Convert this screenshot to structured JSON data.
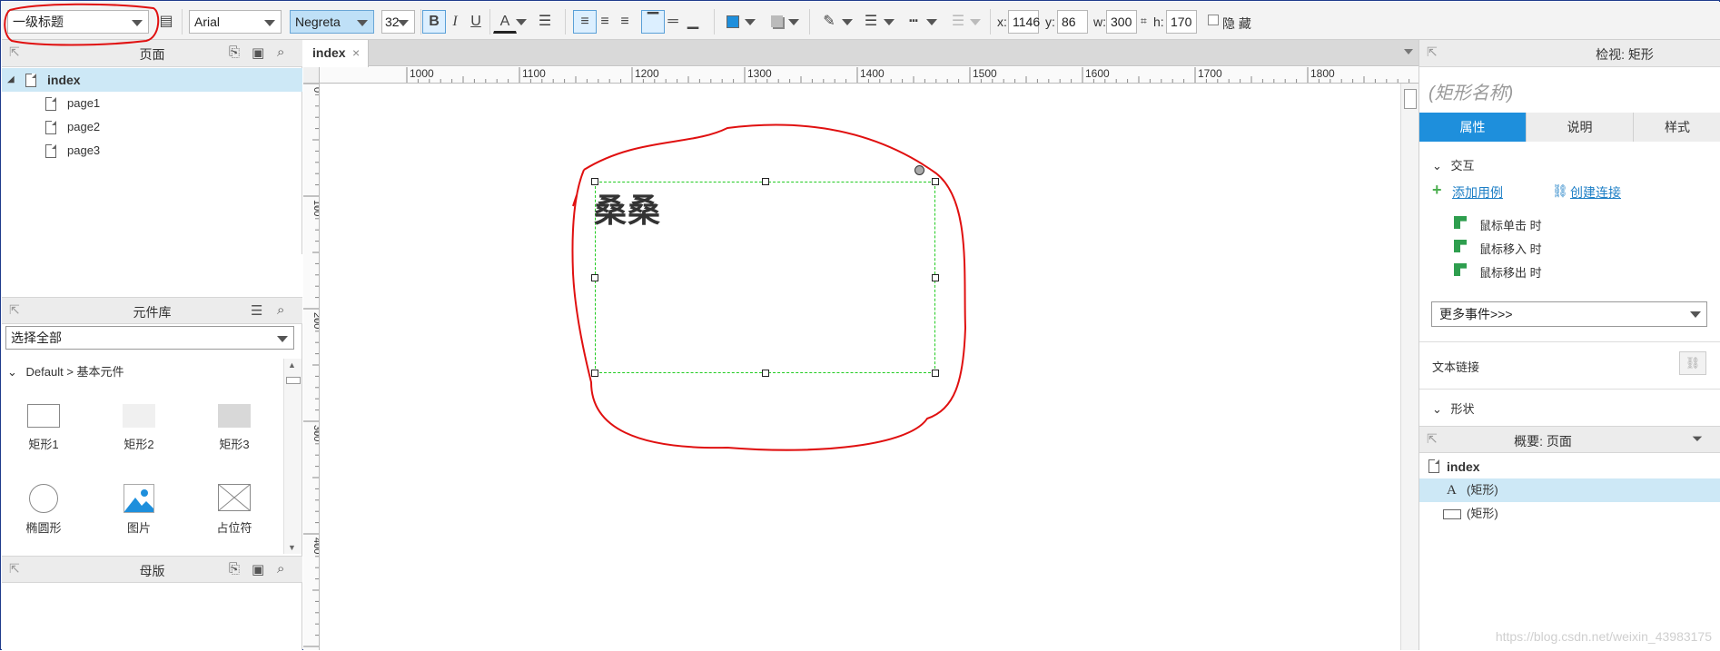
{
  "toolbar": {
    "style_select": "一级标题",
    "font_family": "Arial",
    "font_weight": "Negreta",
    "font_size": "32",
    "bold": "B",
    "italic": "I",
    "underline": "U",
    "font_color_glyph": "A",
    "x_label": "x:",
    "x_value": "1146",
    "y_label": "y:",
    "y_value": "86",
    "w_label": "w:",
    "w_value": "300",
    "h_label": "h:",
    "h_value": "170",
    "hidden_label": "隐 藏",
    "fill_color": "#1e8fdc"
  },
  "pages_panel": {
    "title": "页面",
    "root": "index",
    "children": [
      "page1",
      "page2",
      "page3"
    ]
  },
  "library_panel": {
    "title": "元件库",
    "select_value": "选择全部",
    "group": "Default > 基本元件",
    "widgets": [
      "矩形1",
      "矩形2",
      "矩形3",
      "椭圆形",
      "图片",
      "占位符"
    ]
  },
  "masters_panel": {
    "title": "母版"
  },
  "canvas": {
    "tab": "index",
    "tab_close": "×",
    "ruler_h": [
      "1000",
      "1100",
      "1200",
      "1300",
      "1400",
      "1500",
      "1600",
      "1700",
      "1800"
    ],
    "ruler_v": [
      "0",
      "100",
      "200",
      "300",
      "400"
    ],
    "shape_text": "桑桑"
  },
  "inspector": {
    "title": "检视: 矩形",
    "name_placeholder": "(矩形名称)",
    "tabs": [
      "属性",
      "说明",
      "样式"
    ],
    "interaction_title": "交互",
    "add_case": "添加用例",
    "create_link": "创建连接",
    "events": [
      "鼠标单击 时",
      "鼠标移入 时",
      "鼠标移出 时"
    ],
    "more_events": "更多事件>>>",
    "text_link": "文本链接",
    "shape_section": "形状"
  },
  "outline": {
    "title": "概要: 页面",
    "root": "index",
    "items": [
      "(矩形)",
      "(矩形)"
    ]
  },
  "watermark": "https://blog.csdn.net/weixin_43983175",
  "colors": {
    "accent": "#1e8fdc",
    "annotation": "#e01010",
    "selection": "#22cc22"
  }
}
